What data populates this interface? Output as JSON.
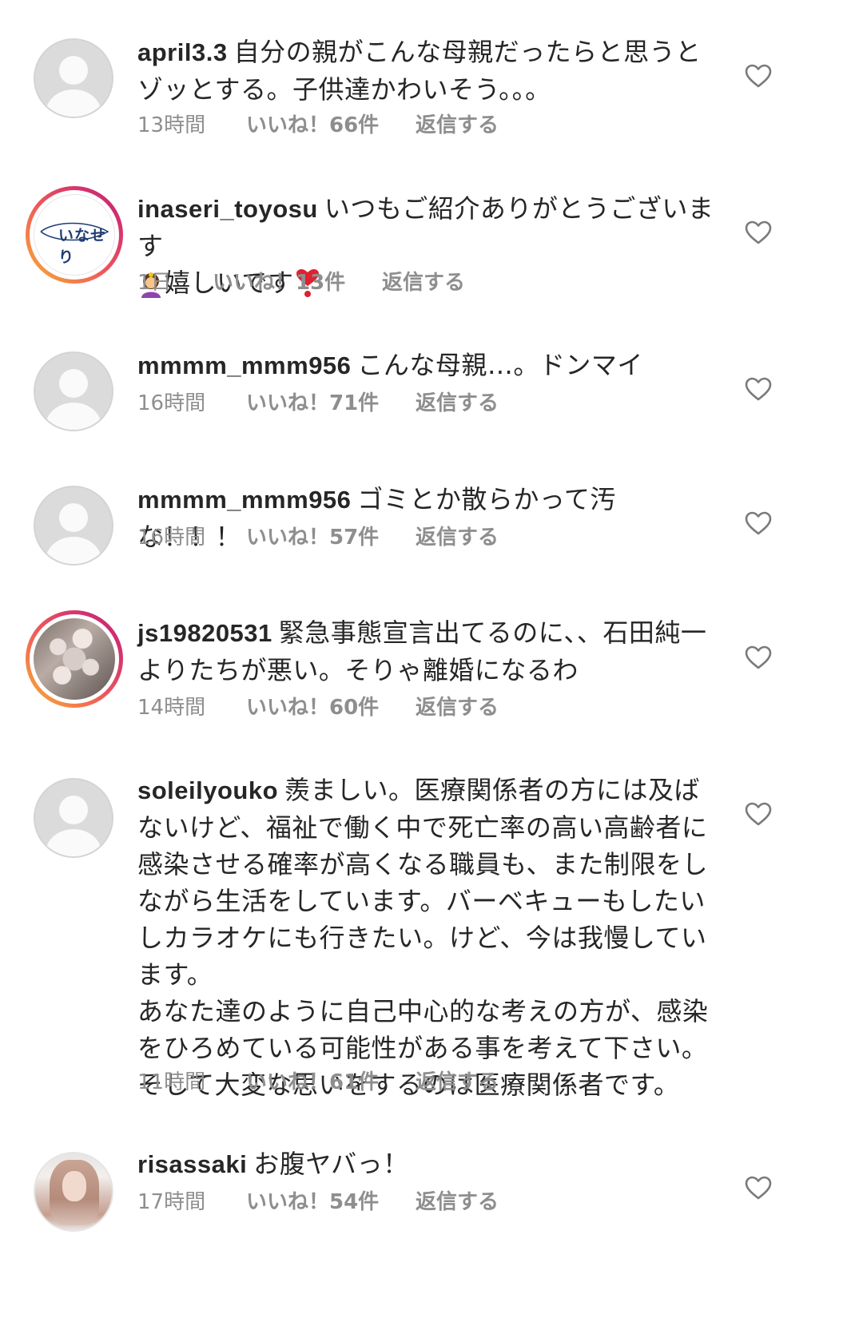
{
  "comments": [
    {
      "username": "april3.3",
      "text": "自分の親がこんな母親だったらと思うとゾッとする。子供達かわいそう。。。",
      "time": "13時間",
      "likes": "いいね！66件",
      "reply": "返信する",
      "avatar": "default-avatar-icon"
    },
    {
      "username": "inaseri_toyosu",
      "text": "いつもご紹介ありがとうございます",
      "text_after_emoji": "嬉しいです",
      "emoji_before": "woman-bowing-emoji",
      "emoji_after": "heavy-heart-exclamation-emoji",
      "time": "1日",
      "likes": "いいね！13件",
      "reply": "返信する",
      "avatar": "logo-avatar",
      "avatar_logo_text": "いなせり"
    },
    {
      "username": "mmmm_mmm956",
      "text": "こんな母親…。ドンマイ",
      "time": "16時間",
      "likes": "いいね！71件",
      "reply": "返信する",
      "avatar": "default-avatar-icon"
    },
    {
      "username": "mmmm_mmm956",
      "text": "ゴミとか散らかって汚な！！！",
      "time": "16時間",
      "likes": "いいね！57件",
      "reply": "返信する",
      "avatar": "default-avatar-icon"
    },
    {
      "username": "js19820531",
      "text": "緊急事態宣言出てるのに、、石田純一よりたちが悪い。そりゃ離婚になるわ",
      "time": "14時間",
      "likes": "いいね！60件",
      "reply": "返信する",
      "avatar": "photo-avatar-with-story-ring"
    },
    {
      "username": "soleilyouko",
      "text": "羨ましい。医療関係者の方には及ばないけど、福祉で働く中で死亡率の高い高齢者に感染させる確率が高くなる職員も、また制限をしながら生活をしています。バーベキューもしたいしカラオケにも行きたい。けど、今は我慢しています。\nあなた達のように自己中心的な考えの方が、感染をひろめている可能性がある事を考えて下さい。そして大変な思いをするのは医療関係者です。",
      "time": "11時間",
      "likes": "いいね！61件",
      "reply": "返信する",
      "avatar": "default-avatar-icon"
    },
    {
      "username": "risassaki",
      "text": "お腹ヤバっ！",
      "time": "17時間",
      "likes": "いいね！54件",
      "reply": "返信する",
      "avatar": "photo-avatar"
    }
  ],
  "icons": {
    "like": "heart-outline-icon"
  },
  "colors": {
    "text": "#262626",
    "meta": "#8e8e8e",
    "story_ring_start": "#f9b233",
    "story_ring_end": "#c1197a"
  }
}
